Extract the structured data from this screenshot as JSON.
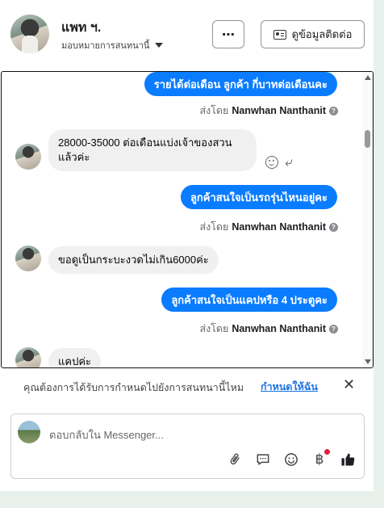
{
  "header": {
    "name": "แพท ฯ.",
    "assign_label": "มอบหมายการสนทนานี้",
    "more_label": "⋯",
    "contact_label": "ดูข้อมูลติดต่อ"
  },
  "messages": [
    {
      "dir": "out",
      "text": "รายได้ต่อเดือน ลูกค้า  กี่บาทต่อเดือนคะ",
      "sent_prefix": "ส่งโดย",
      "sender": "Nanwhan Nanthanit"
    },
    {
      "dir": "in",
      "text": "28000-35000 ต่อเดือนแบ่งเจ้าของสวนแล้วค่ะ"
    },
    {
      "dir": "out",
      "text": "ลูกค้าสนใจเป็นรถรุ่นไหนอยู่คะ",
      "sent_prefix": "ส่งโดย",
      "sender": "Nanwhan Nanthanit"
    },
    {
      "dir": "in",
      "text": "ขอดูเป็นกระบะงวดไม่เกิน6000ค่ะ"
    },
    {
      "dir": "out",
      "text": "ลูกค้าสนใจเป็นแคปหรือ 4 ประตูคะ",
      "sent_prefix": "ส่งโดย",
      "sender": "Nanwhan Nanthanit"
    },
    {
      "dir": "in",
      "text": "แคปค่ะ"
    }
  ],
  "reminder": {
    "text": "คุณต้องการได้รับการกำหนดไปยังการสนทนานี้ไหม",
    "link": "กำหนดให้ฉัน",
    "close": "✕"
  },
  "composer": {
    "placeholder": "ตอบกลับใน Messenger...",
    "tools": [
      "paperclip-icon",
      "chat-bubble-icon",
      "emoji-icon",
      "baht-icon",
      "thumbs-up-icon"
    ],
    "baht_symbol": "฿"
  },
  "colors": {
    "outgoing": "#0a7cff",
    "incoming": "#f0f0f0",
    "link": "#1b74e4"
  }
}
